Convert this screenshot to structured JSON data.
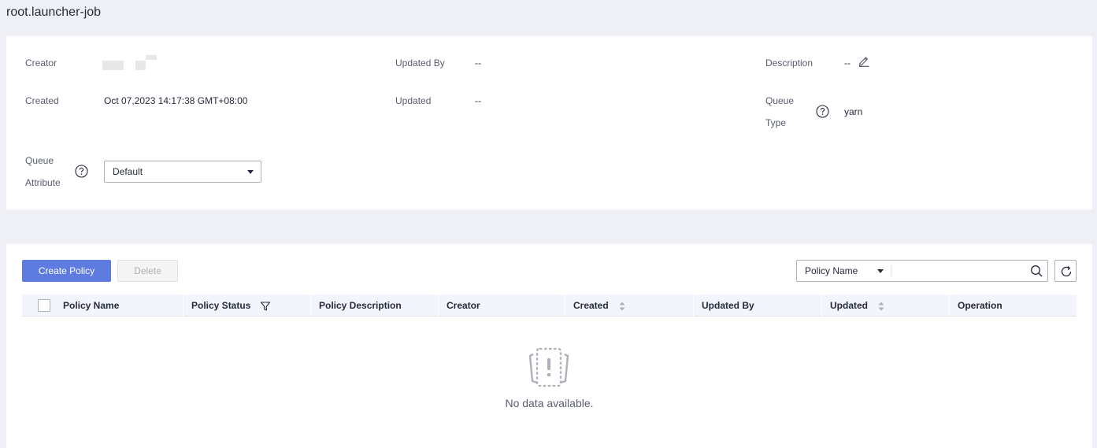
{
  "page": {
    "title": "root.launcher-job"
  },
  "info": {
    "creator_label": "Creator",
    "updated_by_label": "Updated By",
    "updated_by_value": "--",
    "description_label": "Description",
    "description_value": "--",
    "created_label": "Created",
    "created_value": "Oct 07,2023 14:17:38 GMT+08:00",
    "updated_label": "Updated",
    "updated_value": "--",
    "queue_type_label_1": "Queue",
    "queue_type_label_2": "Type",
    "queue_type_value": "yarn",
    "queue_attribute_label_1": "Queue",
    "queue_attribute_label_2": "Attribute",
    "queue_attribute_value": "Default"
  },
  "toolbar": {
    "create_label": "Create Policy",
    "delete_label": "Delete",
    "search_field": "Policy Name",
    "search_value": ""
  },
  "table": {
    "columns": [
      "Policy Name",
      "Policy Status",
      "Policy Description",
      "Creator",
      "Created",
      "Updated By",
      "Updated",
      "Operation"
    ],
    "empty_text": "No data available."
  },
  "colors": {
    "primary": "#5e7ce0",
    "background": "#eff0f5",
    "header_bg": "#f2f5fc"
  }
}
